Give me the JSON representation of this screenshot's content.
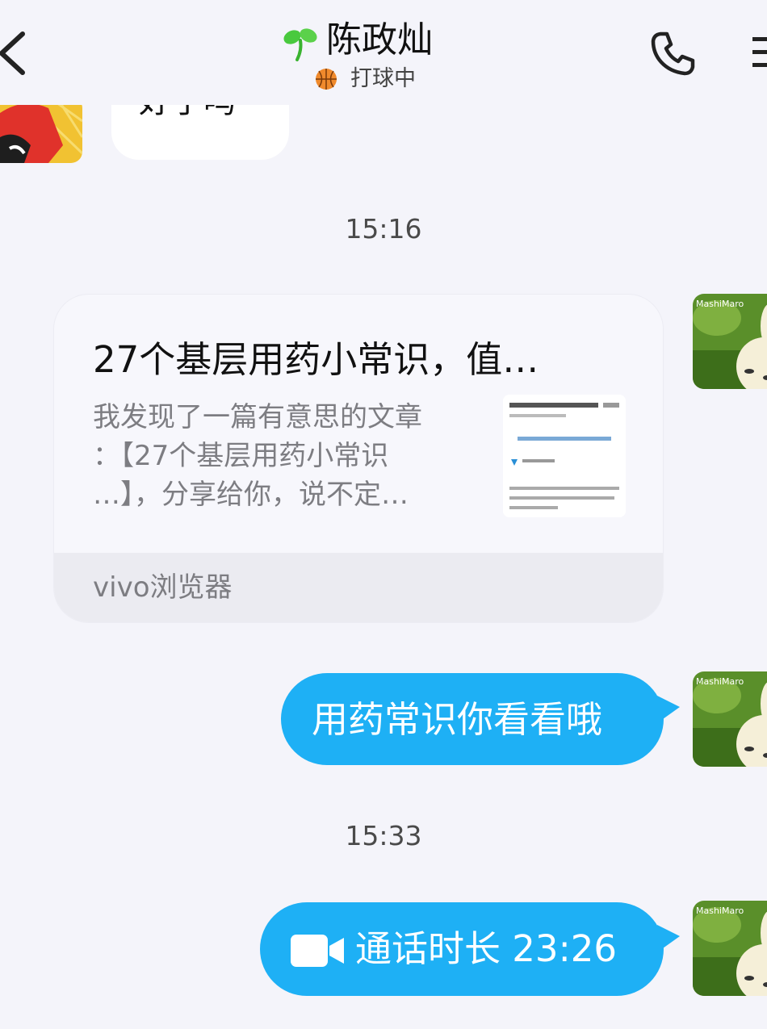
{
  "header": {
    "contact_name": "陈政灿",
    "status_text": "打球中"
  },
  "icons": {
    "back": "chevron-left-icon",
    "status_emoji": "basketball-icon",
    "name_badge": "sprout-icon",
    "call": "phone-icon",
    "menu": "menu-icon"
  },
  "previous_message": {
    "text": "好了吗"
  },
  "timestamps": [
    "15:16",
    "15:33"
  ],
  "link_card": {
    "title": "27个基层用药小常识，值…",
    "description_lines": [
      "我发现了一篇有意思的文章",
      "：【27个基层用药小常识",
      "…】，分享给你，说不定…"
    ],
    "source": "vivo浏览器"
  },
  "messages": {
    "text_message": "用药常识你看看哦",
    "call_record": "通话时长 23:26"
  },
  "avatar_labels": {
    "mine": "MashiMaro"
  },
  "colors": {
    "background": "#f4f4fa",
    "sent_bubble": "#1eb0f5",
    "card_bg": "#f7f7fc",
    "card_footer": "#ebebf1"
  }
}
